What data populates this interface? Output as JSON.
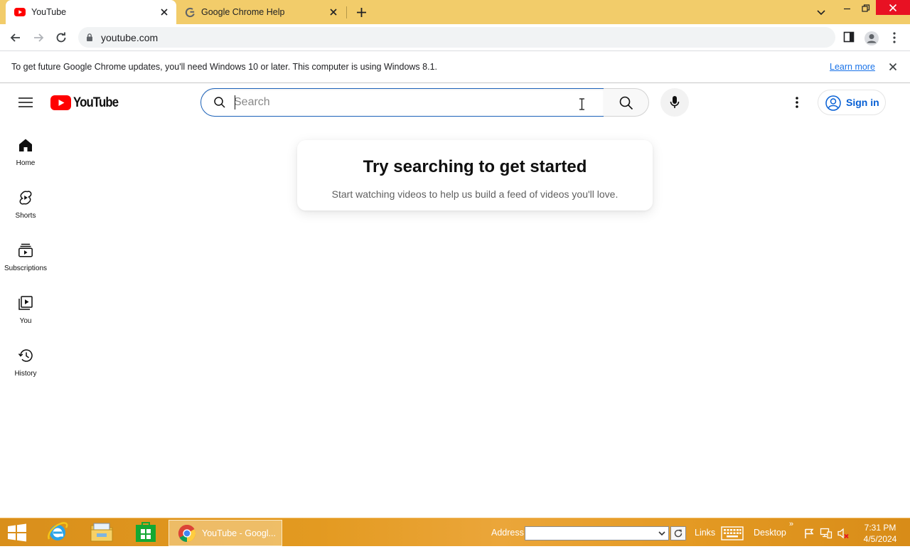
{
  "browser": {
    "tabs": [
      {
        "title": "YouTube",
        "favicon": "youtube-favicon",
        "active": true
      },
      {
        "title": "Google Chrome Help",
        "favicon": "google-favicon",
        "active": false
      }
    ],
    "address": "youtube.com",
    "infobar": {
      "message": "To get future Google Chrome updates, you'll need Windows 10 or later. This computer is using Windows 8.1.",
      "link": "Learn more"
    },
    "colors": {
      "tabstrip": "#f2cc6a",
      "link": "#1a73e8"
    }
  },
  "youtube": {
    "logo_text": "YouTube",
    "search": {
      "placeholder": "Search",
      "value": ""
    },
    "signin_label": "Sign in",
    "guide": [
      {
        "label": "Home",
        "icon": "home-icon"
      },
      {
        "label": "Shorts",
        "icon": "shorts-icon"
      },
      {
        "label": "Subscriptions",
        "icon": "subscriptions-icon"
      },
      {
        "label": "You",
        "icon": "you-icon"
      },
      {
        "label": "History",
        "icon": "history-icon"
      }
    ],
    "empty_state": {
      "title": "Try searching to get started",
      "subtitle": "Start watching videos to help us build a feed of videos you'll love."
    },
    "colors": {
      "brand_red": "#ff0000",
      "signin_blue": "#065fd4"
    }
  },
  "taskbar": {
    "active_window": "YouTube - Googl...",
    "address_label": "Address",
    "links_label": "Links",
    "desktop_label": "Desktop",
    "overflow": "»",
    "time": "7:31 PM",
    "date": "4/5/2024",
    "pinned": [
      "internet-explorer-icon",
      "file-explorer-icon",
      "store-icon"
    ]
  }
}
